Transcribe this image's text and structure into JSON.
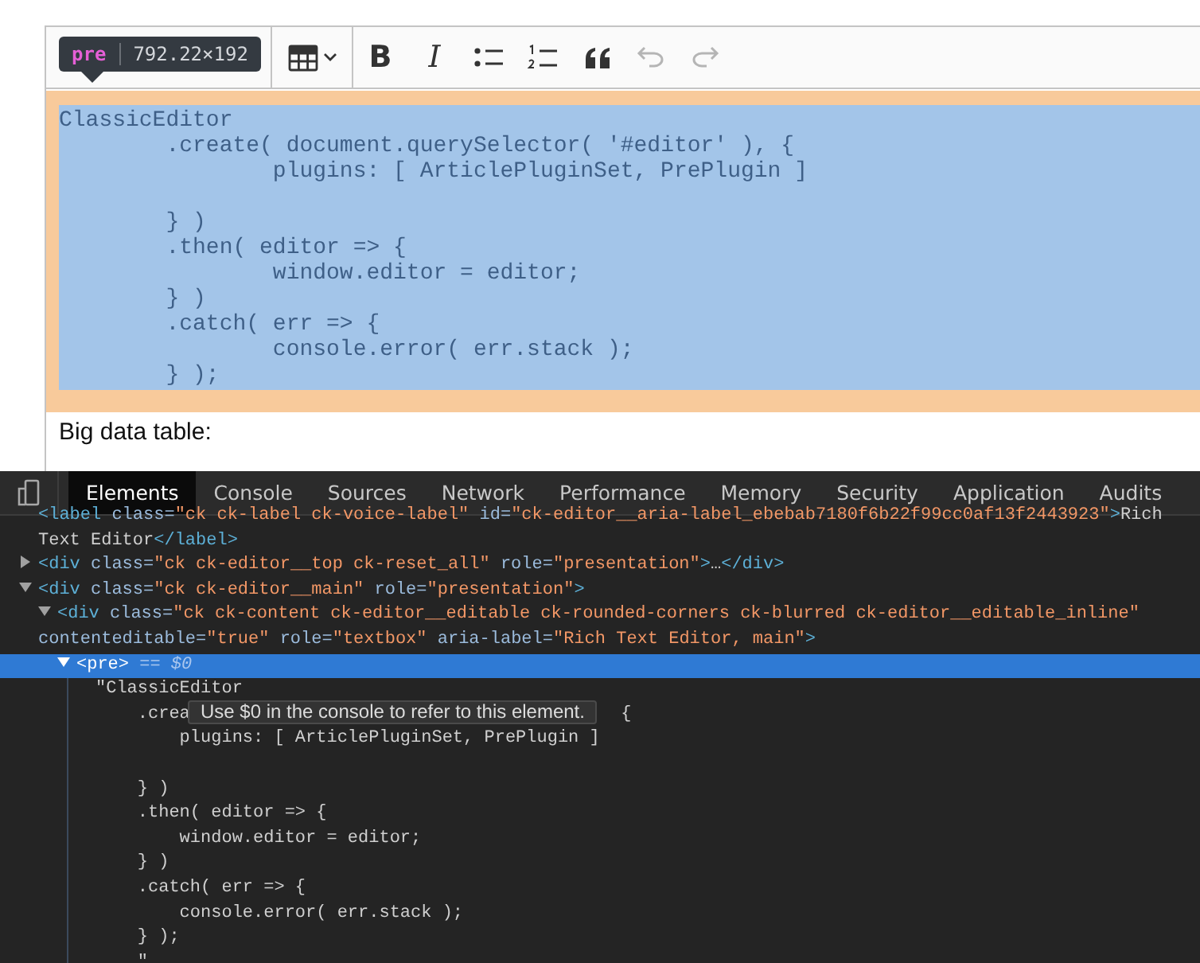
{
  "inspect_tooltip": {
    "tag": "pre",
    "size": "792.22×192"
  },
  "toolbar": [
    {
      "kind": "table",
      "disabled": false
    },
    {
      "kind": "text",
      "label": "B",
      "disabled": false
    },
    {
      "kind": "text_italic",
      "label": "I",
      "disabled": false
    },
    {
      "kind": "bulleted",
      "disabled": false
    },
    {
      "kind": "numbered",
      "disabled": false
    },
    {
      "kind": "quote",
      "disabled": false
    },
    {
      "kind": "undo",
      "disabled": true
    },
    {
      "kind": "redo",
      "disabled": true
    }
  ],
  "editor": {
    "code": "ClassicEditor\n\t.create( document.querySelector( '#editor' ), {\n\t\tplugins: [ ArticlePluginSet, PrePlugin ]\n\n\t} )\n\t.then( editor => {\n\t\twindow.editor = editor;\n\t} )\n\t.catch( err => {\n\t\tconsole.error( err.stack );\n\t} );",
    "paragraph": "Big data table:"
  },
  "devtools": {
    "tabs": [
      {
        "label": "Elements",
        "selected": true
      },
      {
        "label": "Console",
        "selected": false
      },
      {
        "label": "Sources",
        "selected": false
      },
      {
        "label": "Network",
        "selected": false
      },
      {
        "label": "Performance",
        "selected": false
      },
      {
        "label": "Memory",
        "selected": false
      },
      {
        "label": "Security",
        "selected": false
      },
      {
        "label": "Application",
        "selected": false
      },
      {
        "label": "Audits",
        "selected": false
      }
    ],
    "dom_tree": [
      {
        "kind": "leaf",
        "selected": false,
        "tokens": [
          {
            "kind": "tag",
            "text": "<label"
          },
          {
            "kind": "attr",
            "text": " class="
          },
          {
            "kind": "value",
            "text": "\"ck ck-label ck-voice-label\""
          },
          {
            "kind": "attr",
            "text": " id="
          },
          {
            "kind": "value",
            "text": "\"ck-editor__aria-label_ebebab7180f6b22f99cc0af13f2443923\""
          },
          {
            "kind": "tag",
            "text": ">"
          },
          {
            "kind": "text",
            "text": "Rich Text Editor"
          },
          {
            "kind": "tag",
            "text": "</label>"
          }
        ]
      },
      {
        "kind": "node",
        "selected": false,
        "expanded": false,
        "tokens": [
          {
            "kind": "tag",
            "text": "<div"
          },
          {
            "kind": "attr",
            "text": " class="
          },
          {
            "kind": "value",
            "text": "\"ck ck-editor__top ck-reset_all\""
          },
          {
            "kind": "attr",
            "text": " role="
          },
          {
            "kind": "value",
            "text": "\"presentation\""
          },
          {
            "kind": "tag",
            "text": ">"
          },
          {
            "kind": "text",
            "text": "…"
          },
          {
            "kind": "tag",
            "text": "</div>"
          }
        ]
      },
      {
        "kind": "node",
        "selected": false,
        "expanded": true,
        "tokens": [
          {
            "kind": "tag",
            "text": "<div"
          },
          {
            "kind": "attr",
            "text": " class="
          },
          {
            "kind": "value",
            "text": "\"ck ck-editor__main\""
          },
          {
            "kind": "attr",
            "text": " role="
          },
          {
            "kind": "value",
            "text": "\"presentation\""
          },
          {
            "kind": "tag",
            "text": ">"
          }
        ],
        "children": [
          {
            "kind": "node",
            "selected": false,
            "expanded": true,
            "tokens": [
              {
                "kind": "tag",
                "text": "<div"
              },
              {
                "kind": "attr",
                "text": " class="
              },
              {
                "kind": "value",
                "text": "\"ck ck-content ck-editor__editable ck-rounded-corners ck-blurred ck-editor__editable_inline\""
              },
              {
                "kind": "attr",
                "text": " contenteditable="
              },
              {
                "kind": "value",
                "text": "\"true\""
              },
              {
                "kind": "attr",
                "text": " role="
              },
              {
                "kind": "value",
                "text": "\"textbox\""
              },
              {
                "kind": "attr",
                "text": " aria-label="
              },
              {
                "kind": "value",
                "text": "\"Rich Text Editor, main\""
              },
              {
                "kind": "tag",
                "text": ">"
              }
            ],
            "children": [
              {
                "kind": "node",
                "selected": true,
                "expanded": true,
                "console_ref": "== $0",
                "tokens": [
                  {
                    "kind": "tag",
                    "text": "<pre>"
                  }
                ],
                "children": [
                  {
                    "kind": "text",
                    "head": "\"ClassicEditor\n    .crea",
                    "tail": "{",
                    "body": "        plugins: [ ArticlePluginSet, PrePlugin ]\n\n    } )\n    .then( editor => {\n        window.editor = editor;\n    } )\n    .catch( err => {\n        console.error( err.stack );\n    } );\n    \""
                  }
                ]
              }
            ]
          }
        ]
      }
    ],
    "hover_tooltip": "Use $0 in the console to refer to this element."
  }
}
